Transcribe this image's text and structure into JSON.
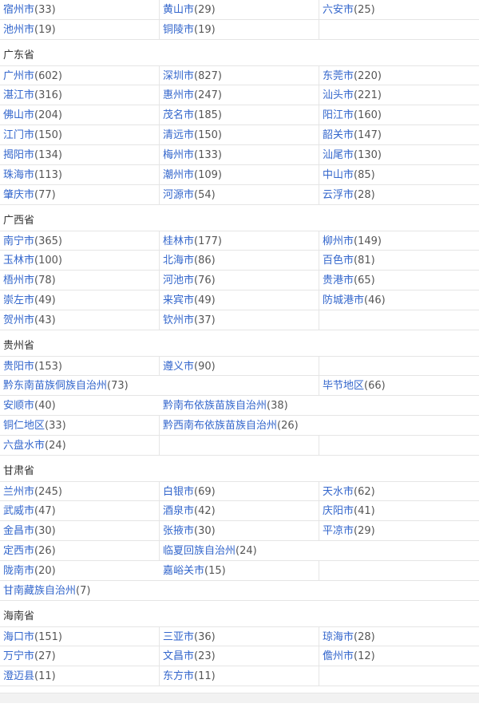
{
  "sections": [
    {
      "province": "",
      "rows": [
        [
          {
            "name": "宿州市",
            "count": "(33)"
          },
          {
            "name": "黄山市",
            "count": "(29)"
          },
          {
            "name": "六安市",
            "count": "(25)"
          }
        ],
        [
          {
            "name": "池州市",
            "count": "(19)"
          },
          {
            "name": "铜陵市",
            "count": "(19)"
          },
          null
        ]
      ]
    },
    {
      "province": "广东省",
      "rows": [
        [
          {
            "name": "广州市",
            "count": "(602)"
          },
          {
            "name": "深圳市",
            "count": "(827)"
          },
          {
            "name": "东莞市",
            "count": "(220)"
          }
        ],
        [
          {
            "name": "湛江市",
            "count": "(316)"
          },
          {
            "name": "惠州市",
            "count": "(247)"
          },
          {
            "name": "汕头市",
            "count": "(221)"
          }
        ],
        [
          {
            "name": "佛山市",
            "count": "(204)"
          },
          {
            "name": "茂名市",
            "count": "(185)"
          },
          {
            "name": "阳江市",
            "count": "(160)"
          }
        ],
        [
          {
            "name": "江门市",
            "count": "(150)"
          },
          {
            "name": "清远市",
            "count": "(150)"
          },
          {
            "name": "韶关市",
            "count": "(147)"
          }
        ],
        [
          {
            "name": "揭阳市",
            "count": "(134)"
          },
          {
            "name": "梅州市",
            "count": "(133)"
          },
          {
            "name": "汕尾市",
            "count": "(130)"
          }
        ],
        [
          {
            "name": "珠海市",
            "count": "(113)"
          },
          {
            "name": "潮州市",
            "count": "(109)"
          },
          {
            "name": "中山市",
            "count": "(85)"
          }
        ],
        [
          {
            "name": "肇庆市",
            "count": "(77)"
          },
          {
            "name": "河源市",
            "count": "(54)"
          },
          {
            "name": "云浮市",
            "count": "(28)"
          }
        ]
      ]
    },
    {
      "province": "广西省",
      "rows": [
        [
          {
            "name": "南宁市",
            "count": "(365)"
          },
          {
            "name": "桂林市",
            "count": "(177)"
          },
          {
            "name": "柳州市",
            "count": "(149)"
          }
        ],
        [
          {
            "name": "玉林市",
            "count": "(100)"
          },
          {
            "name": "北海市",
            "count": "(86)"
          },
          {
            "name": "百色市",
            "count": "(81)"
          }
        ],
        [
          {
            "name": "梧州市",
            "count": "(78)"
          },
          {
            "name": "河池市",
            "count": "(76)"
          },
          {
            "name": "贵港市",
            "count": "(65)"
          }
        ],
        [
          {
            "name": "崇左市",
            "count": "(49)"
          },
          {
            "name": "来宾市",
            "count": "(49)"
          },
          {
            "name": "防城港市",
            "count": "(46)"
          }
        ],
        [
          {
            "name": "贺州市",
            "count": "(43)"
          },
          {
            "name": "钦州市",
            "count": "(37)"
          },
          null
        ]
      ]
    },
    {
      "province": "贵州省",
      "rows": [
        [
          {
            "name": "贵阳市",
            "count": "(153)"
          },
          {
            "name": "遵义市",
            "count": "(90)"
          },
          null
        ],
        [
          {
            "name": "黔东南苗族侗族自治州",
            "count": "(73)",
            "span": 2
          },
          {
            "name": "毕节地区",
            "count": "(66)"
          }
        ],
        [
          {
            "name": "安顺市",
            "count": "(40)"
          },
          {
            "name": "黔南布依族苗族自治州",
            "count": "(38)",
            "span": 2
          }
        ],
        [
          {
            "name": "铜仁地区",
            "count": "(33)"
          },
          {
            "name": "黔西南布依族苗族自治州",
            "count": "(26)",
            "span": 2
          }
        ],
        [
          {
            "name": "六盘水市",
            "count": "(24)"
          },
          null,
          null
        ]
      ]
    },
    {
      "province": "甘肃省",
      "rows": [
        [
          {
            "name": "兰州市",
            "count": "(245)"
          },
          {
            "name": "白银市",
            "count": "(69)"
          },
          {
            "name": "天水市",
            "count": "(62)"
          }
        ],
        [
          {
            "name": "武威市",
            "count": "(47)"
          },
          {
            "name": "酒泉市",
            "count": "(42)"
          },
          {
            "name": "庆阳市",
            "count": "(41)"
          }
        ],
        [
          {
            "name": "金昌市",
            "count": "(30)"
          },
          {
            "name": "张掖市",
            "count": "(30)"
          },
          {
            "name": "平凉市",
            "count": "(29)"
          }
        ],
        [
          {
            "name": "定西市",
            "count": "(26)"
          },
          {
            "name": "临夏回族自治州",
            "count": "(24)",
            "span": 2
          }
        ],
        [
          {
            "name": "陇南市",
            "count": "(20)"
          },
          {
            "name": "嘉峪关市",
            "count": "(15)"
          },
          null
        ],
        [
          {
            "name": "甘南藏族自治州",
            "count": "(7)",
            "span": 2
          },
          null
        ]
      ]
    },
    {
      "province": "海南省",
      "rows": [
        [
          {
            "name": "海口市",
            "count": "(151)"
          },
          {
            "name": "三亚市",
            "count": "(36)"
          },
          {
            "name": "琼海市",
            "count": "(28)"
          }
        ],
        [
          {
            "name": "万宁市",
            "count": "(27)"
          },
          {
            "name": "文昌市",
            "count": "(23)"
          },
          {
            "name": "儋州市",
            "count": "(12)"
          }
        ],
        [
          {
            "name": "澄迈县",
            "count": "(11)"
          },
          {
            "name": "东方市",
            "count": "(11)"
          },
          null
        ]
      ]
    }
  ]
}
